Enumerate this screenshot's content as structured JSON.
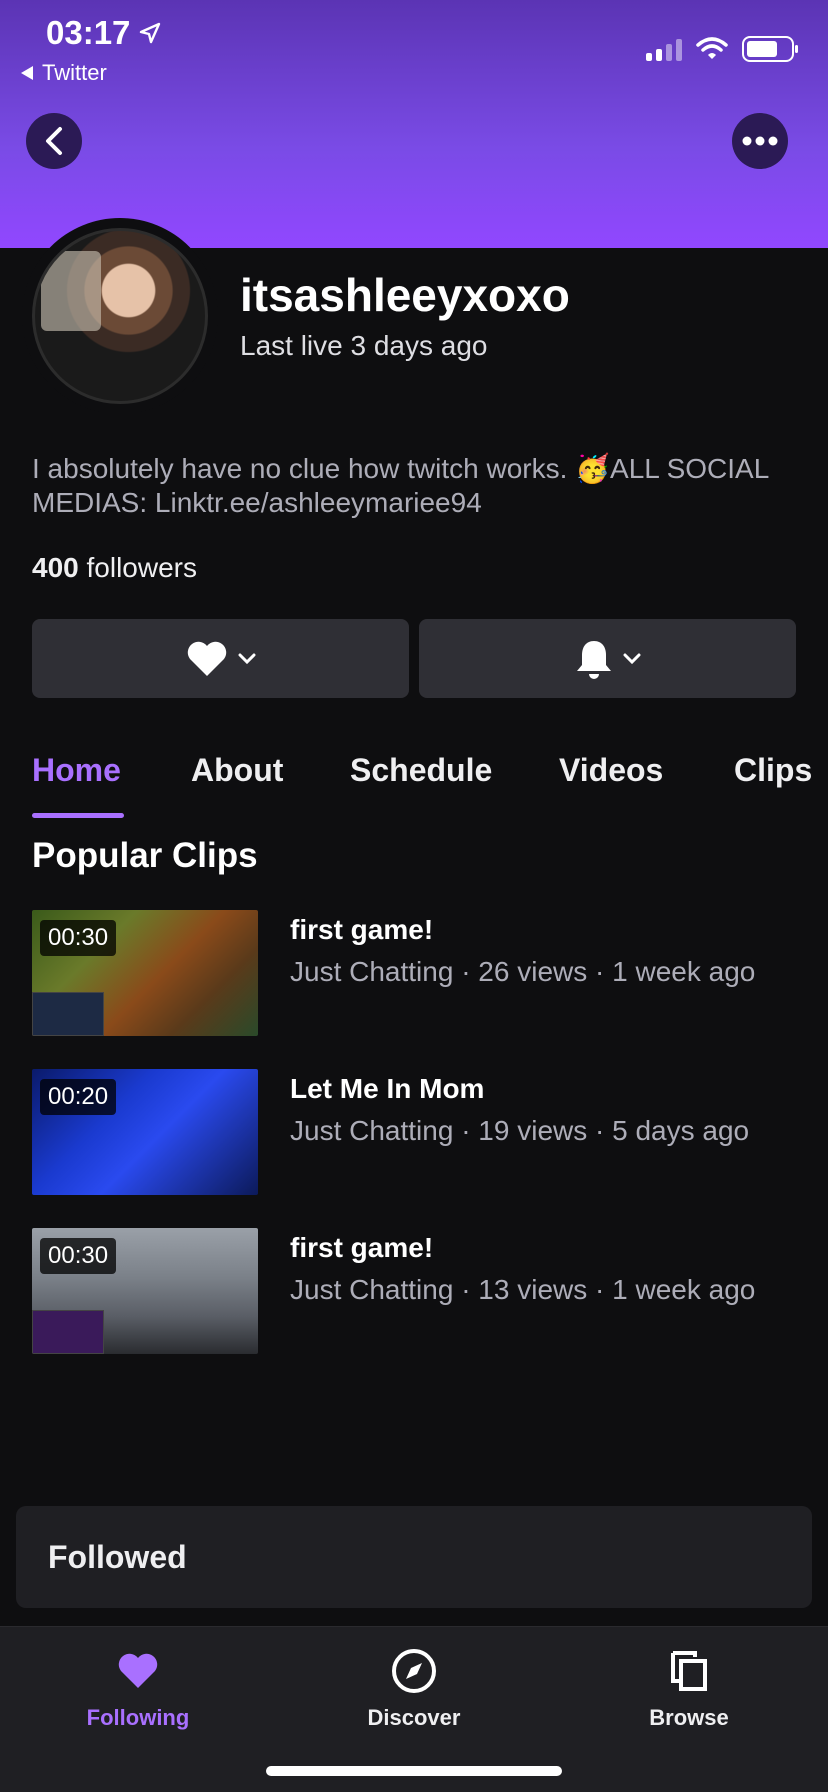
{
  "status_bar": {
    "time": "03:17",
    "back_app": "Twitter"
  },
  "profile": {
    "username": "itsashleeyxoxo",
    "last_live": "Last live 3 days ago",
    "bio": "I absolutely have no clue how twitch works. 🥳ALL SOCIAL MEDIAS: Linktr.ee/ashleeymariee94",
    "followers_count": "400",
    "followers_label": "followers"
  },
  "tabs": [
    "Home",
    "About",
    "Schedule",
    "Videos",
    "Clips"
  ],
  "active_tab": "Home",
  "popular_clips": {
    "title": "Popular Clips",
    "items": [
      {
        "duration": "00:30",
        "title": "first game!",
        "meta": "Just Chatting · 26 views · 1 week ago"
      },
      {
        "duration": "00:20",
        "title": "Let Me In Mom",
        "meta": "Just Chatting · 19 views · 5 days ago"
      },
      {
        "duration": "00:30",
        "title": "first game!",
        "meta": "Just Chatting · 13 views · 1 week ago"
      }
    ]
  },
  "toast": {
    "text": "Followed"
  },
  "bottom_nav": [
    {
      "label": "Following",
      "icon": "heart-icon",
      "active": true
    },
    {
      "label": "Discover",
      "icon": "compass-icon",
      "active": false
    },
    {
      "label": "Browse",
      "icon": "browse-icon",
      "active": false
    }
  ],
  "colors": {
    "accent": "#a970ff",
    "header": "#9147ff",
    "background": "#0e0e10"
  }
}
